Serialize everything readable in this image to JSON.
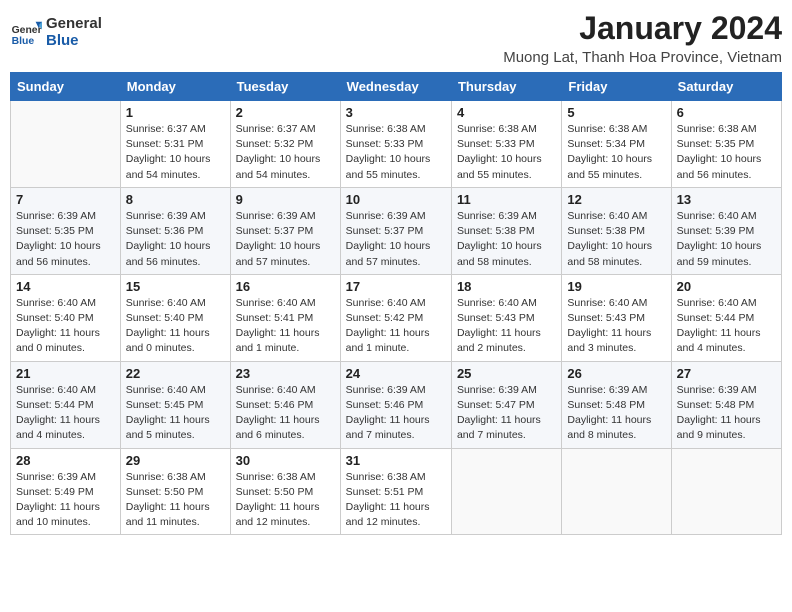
{
  "header": {
    "logo_general": "General",
    "logo_blue": "Blue",
    "month_title": "January 2024",
    "location": "Muong Lat, Thanh Hoa Province, Vietnam"
  },
  "weekdays": [
    "Sunday",
    "Monday",
    "Tuesday",
    "Wednesday",
    "Thursday",
    "Friday",
    "Saturday"
  ],
  "weeks": [
    [
      {
        "day": "",
        "info": ""
      },
      {
        "day": "1",
        "info": "Sunrise: 6:37 AM\nSunset: 5:31 PM\nDaylight: 10 hours\nand 54 minutes."
      },
      {
        "day": "2",
        "info": "Sunrise: 6:37 AM\nSunset: 5:32 PM\nDaylight: 10 hours\nand 54 minutes."
      },
      {
        "day": "3",
        "info": "Sunrise: 6:38 AM\nSunset: 5:33 PM\nDaylight: 10 hours\nand 55 minutes."
      },
      {
        "day": "4",
        "info": "Sunrise: 6:38 AM\nSunset: 5:33 PM\nDaylight: 10 hours\nand 55 minutes."
      },
      {
        "day": "5",
        "info": "Sunrise: 6:38 AM\nSunset: 5:34 PM\nDaylight: 10 hours\nand 55 minutes."
      },
      {
        "day": "6",
        "info": "Sunrise: 6:38 AM\nSunset: 5:35 PM\nDaylight: 10 hours\nand 56 minutes."
      }
    ],
    [
      {
        "day": "7",
        "info": "Sunrise: 6:39 AM\nSunset: 5:35 PM\nDaylight: 10 hours\nand 56 minutes."
      },
      {
        "day": "8",
        "info": "Sunrise: 6:39 AM\nSunset: 5:36 PM\nDaylight: 10 hours\nand 56 minutes."
      },
      {
        "day": "9",
        "info": "Sunrise: 6:39 AM\nSunset: 5:37 PM\nDaylight: 10 hours\nand 57 minutes."
      },
      {
        "day": "10",
        "info": "Sunrise: 6:39 AM\nSunset: 5:37 PM\nDaylight: 10 hours\nand 57 minutes."
      },
      {
        "day": "11",
        "info": "Sunrise: 6:39 AM\nSunset: 5:38 PM\nDaylight: 10 hours\nand 58 minutes."
      },
      {
        "day": "12",
        "info": "Sunrise: 6:40 AM\nSunset: 5:38 PM\nDaylight: 10 hours\nand 58 minutes."
      },
      {
        "day": "13",
        "info": "Sunrise: 6:40 AM\nSunset: 5:39 PM\nDaylight: 10 hours\nand 59 minutes."
      }
    ],
    [
      {
        "day": "14",
        "info": "Sunrise: 6:40 AM\nSunset: 5:40 PM\nDaylight: 11 hours\nand 0 minutes."
      },
      {
        "day": "15",
        "info": "Sunrise: 6:40 AM\nSunset: 5:40 PM\nDaylight: 11 hours\nand 0 minutes."
      },
      {
        "day": "16",
        "info": "Sunrise: 6:40 AM\nSunset: 5:41 PM\nDaylight: 11 hours\nand 1 minute."
      },
      {
        "day": "17",
        "info": "Sunrise: 6:40 AM\nSunset: 5:42 PM\nDaylight: 11 hours\nand 1 minute."
      },
      {
        "day": "18",
        "info": "Sunrise: 6:40 AM\nSunset: 5:43 PM\nDaylight: 11 hours\nand 2 minutes."
      },
      {
        "day": "19",
        "info": "Sunrise: 6:40 AM\nSunset: 5:43 PM\nDaylight: 11 hours\nand 3 minutes."
      },
      {
        "day": "20",
        "info": "Sunrise: 6:40 AM\nSunset: 5:44 PM\nDaylight: 11 hours\nand 4 minutes."
      }
    ],
    [
      {
        "day": "21",
        "info": "Sunrise: 6:40 AM\nSunset: 5:44 PM\nDaylight: 11 hours\nand 4 minutes."
      },
      {
        "day": "22",
        "info": "Sunrise: 6:40 AM\nSunset: 5:45 PM\nDaylight: 11 hours\nand 5 minutes."
      },
      {
        "day": "23",
        "info": "Sunrise: 6:40 AM\nSunset: 5:46 PM\nDaylight: 11 hours\nand 6 minutes."
      },
      {
        "day": "24",
        "info": "Sunrise: 6:39 AM\nSunset: 5:46 PM\nDaylight: 11 hours\nand 7 minutes."
      },
      {
        "day": "25",
        "info": "Sunrise: 6:39 AM\nSunset: 5:47 PM\nDaylight: 11 hours\nand 7 minutes."
      },
      {
        "day": "26",
        "info": "Sunrise: 6:39 AM\nSunset: 5:48 PM\nDaylight: 11 hours\nand 8 minutes."
      },
      {
        "day": "27",
        "info": "Sunrise: 6:39 AM\nSunset: 5:48 PM\nDaylight: 11 hours\nand 9 minutes."
      }
    ],
    [
      {
        "day": "28",
        "info": "Sunrise: 6:39 AM\nSunset: 5:49 PM\nDaylight: 11 hours\nand 10 minutes."
      },
      {
        "day": "29",
        "info": "Sunrise: 6:38 AM\nSunset: 5:50 PM\nDaylight: 11 hours\nand 11 minutes."
      },
      {
        "day": "30",
        "info": "Sunrise: 6:38 AM\nSunset: 5:50 PM\nDaylight: 11 hours\nand 12 minutes."
      },
      {
        "day": "31",
        "info": "Sunrise: 6:38 AM\nSunset: 5:51 PM\nDaylight: 11 hours\nand 12 minutes."
      },
      {
        "day": "",
        "info": ""
      },
      {
        "day": "",
        "info": ""
      },
      {
        "day": "",
        "info": ""
      }
    ]
  ]
}
